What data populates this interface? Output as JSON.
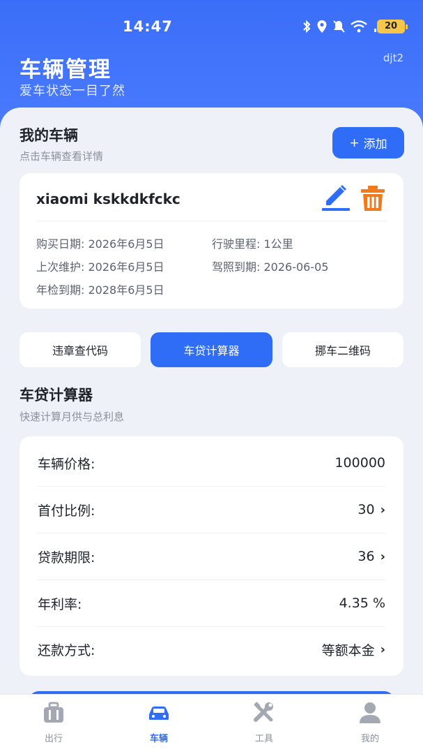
{
  "status_bar": {
    "time": "14:47",
    "battery": "20",
    "icons": [
      "bluetooth-icon",
      "location-icon",
      "mute-icon",
      "wifi-icon",
      "signal-icon"
    ]
  },
  "header": {
    "title": "车辆管理",
    "subtitle": "爱车状态一目了然",
    "user": "djt2"
  },
  "my_vehicles": {
    "title": "我的车辆",
    "subtitle": "点击车辆查看详情",
    "add_button": "添加"
  },
  "vehicle": {
    "name": "xiaomi kskkdkfckc",
    "purchase_label": "购买日期:",
    "purchase_date": "2026年6月5日",
    "mileage_label": "行驶里程:",
    "mileage": "1公里",
    "maintenance_label": "上次维护:",
    "maintenance_date": "2026年6月5日",
    "license_label": "驾照到期:",
    "license_date": "2026-06-05",
    "inspection_label": "年检到期:",
    "inspection_date": "2028年6月5日"
  },
  "tabs": [
    {
      "label": "违章查代码",
      "active": false
    },
    {
      "label": "车贷计算器",
      "active": true
    },
    {
      "label": "挪车二维码",
      "active": false
    }
  ],
  "calculator": {
    "title": "车贷计算器",
    "subtitle": "快速计算月供与总利息",
    "rows": [
      {
        "label": "车辆价格:",
        "value": "100000",
        "chevron": false
      },
      {
        "label": "首付比例:",
        "value": "30",
        "chevron": true
      },
      {
        "label": "贷款期限:",
        "value": "36",
        "chevron": true
      },
      {
        "label": "年利率:",
        "value": "4.35 %",
        "chevron": false
      },
      {
        "label": "还款方式:",
        "value": "等额本金",
        "chevron": true
      }
    ]
  },
  "bottom_nav": [
    {
      "label": "出行",
      "icon": "luggage-icon",
      "active": false
    },
    {
      "label": "车辆",
      "icon": "car-icon",
      "active": true
    },
    {
      "label": "工具",
      "icon": "tools-icon",
      "active": false
    },
    {
      "label": "我的",
      "icon": "user-icon",
      "active": false
    }
  ],
  "colors": {
    "primary": "#2f6df6",
    "header_blue": "#3b6ef8",
    "delete_orange": "#f07a1c",
    "background": "#eef1f8"
  }
}
